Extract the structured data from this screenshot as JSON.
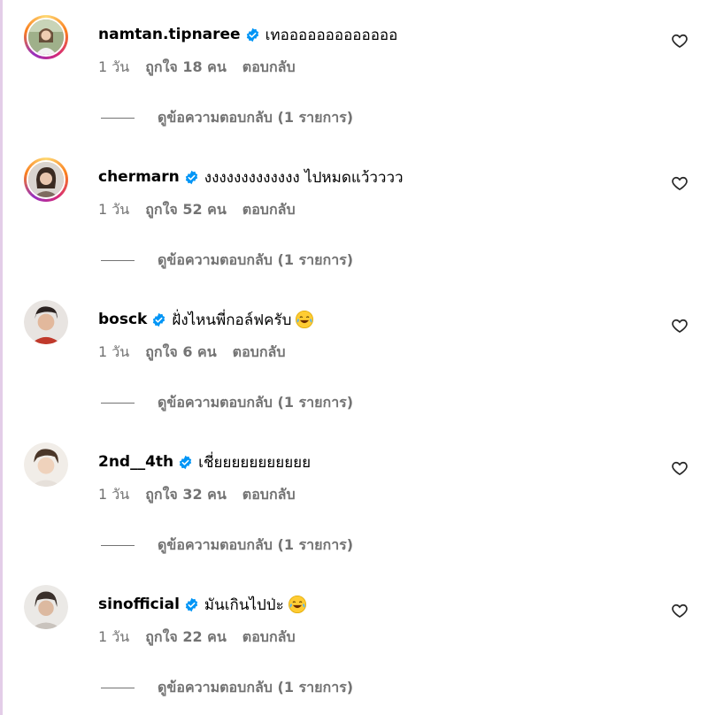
{
  "comments": [
    {
      "username": "namtan.tipnaree",
      "text": "เทอออออออออออออ",
      "emoji": "",
      "time": "1 วัน",
      "likes": "ถูกใจ 18 คน",
      "reply": "ตอบกลับ",
      "view_replies": "ดูข้อความตอบกลับ (1 รายการ)",
      "has_story_ring": true
    },
    {
      "username": "chermarn",
      "text": "งงงงงงงงงงงงง ไปหมดแว้วววว",
      "emoji": "",
      "time": "1 วัน",
      "likes": "ถูกใจ 52 คน",
      "reply": "ตอบกลับ",
      "view_replies": "ดูข้อความตอบกลับ (1 รายการ)",
      "has_story_ring": true
    },
    {
      "username": "bosck",
      "text": "ฝั่งไหนพี่กอล์ฟครับ",
      "emoji": "face-with-tears-of-joy",
      "time": "1 วัน",
      "likes": "ถูกใจ 6 คน",
      "reply": "ตอบกลับ",
      "view_replies": "ดูข้อความตอบกลับ (1 รายการ)",
      "has_story_ring": false
    },
    {
      "username": "2nd__4th",
      "text": "เชี่ยยยยยยยยยยย",
      "emoji": "",
      "time": "1 วัน",
      "likes": "ถูกใจ 32 คน",
      "reply": "ตอบกลับ",
      "view_replies": "ดูข้อความตอบกลับ (1 รายการ)",
      "has_story_ring": false
    },
    {
      "username": "sinofficial",
      "text": "มันเกินไปป่ะ ",
      "emoji": "face-with-tears-of-joy",
      "time": "1 วัน",
      "likes": "ถูกใจ 22 คน",
      "reply": "ตอบกลับ",
      "view_replies": "ดูข้อความตอบกลับ (1 รายการ)",
      "has_story_ring": false
    }
  ],
  "icons": {
    "verified": "verified-badge-icon",
    "like": "heart-outline-icon"
  },
  "colors": {
    "verified_blue": "#0095f6",
    "meta_gray": "#737373",
    "text": "#000000"
  }
}
